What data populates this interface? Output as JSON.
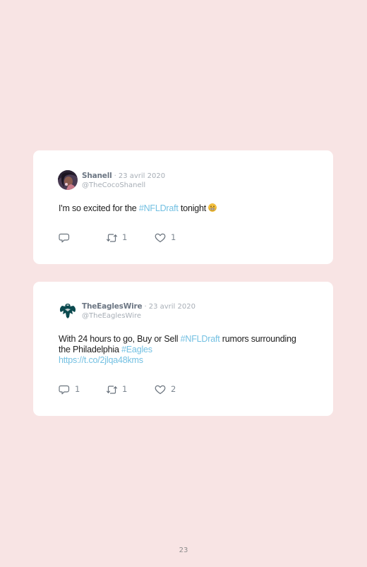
{
  "tweets": [
    {
      "author": "Shanell",
      "separator": "·",
      "date": "23 avril 2020",
      "handle": "@TheCocoShanell",
      "text_before": "I'm so excited for the ",
      "hashtag": "#NFLDraft",
      "text_after": " tonight ",
      "emoji": "grimacing-face",
      "replies": "",
      "retweets": "1",
      "likes": "1"
    },
    {
      "author": "TheEaglesWire",
      "separator": "·",
      "date": "23 avril 2020",
      "handle": "@TheEaglesWire",
      "text_before": "With 24 hours to go, Buy or Sell ",
      "hashtag": "#NFLDraft",
      "text_middle": " rumors surrounding the Philadelphia ",
      "hashtag2": "#Eagles",
      "link": "https://t.co/2jlqa48kms",
      "replies": "1",
      "retweets": "1",
      "likes": "2"
    }
  ],
  "icons": {
    "reply": "reply-icon",
    "retweet": "retweet-icon",
    "like": "heart-icon"
  },
  "colors": {
    "background": "#f8e4e4",
    "link": "#73c0e2",
    "muted": "#a7aeb6"
  },
  "page_number": "23"
}
